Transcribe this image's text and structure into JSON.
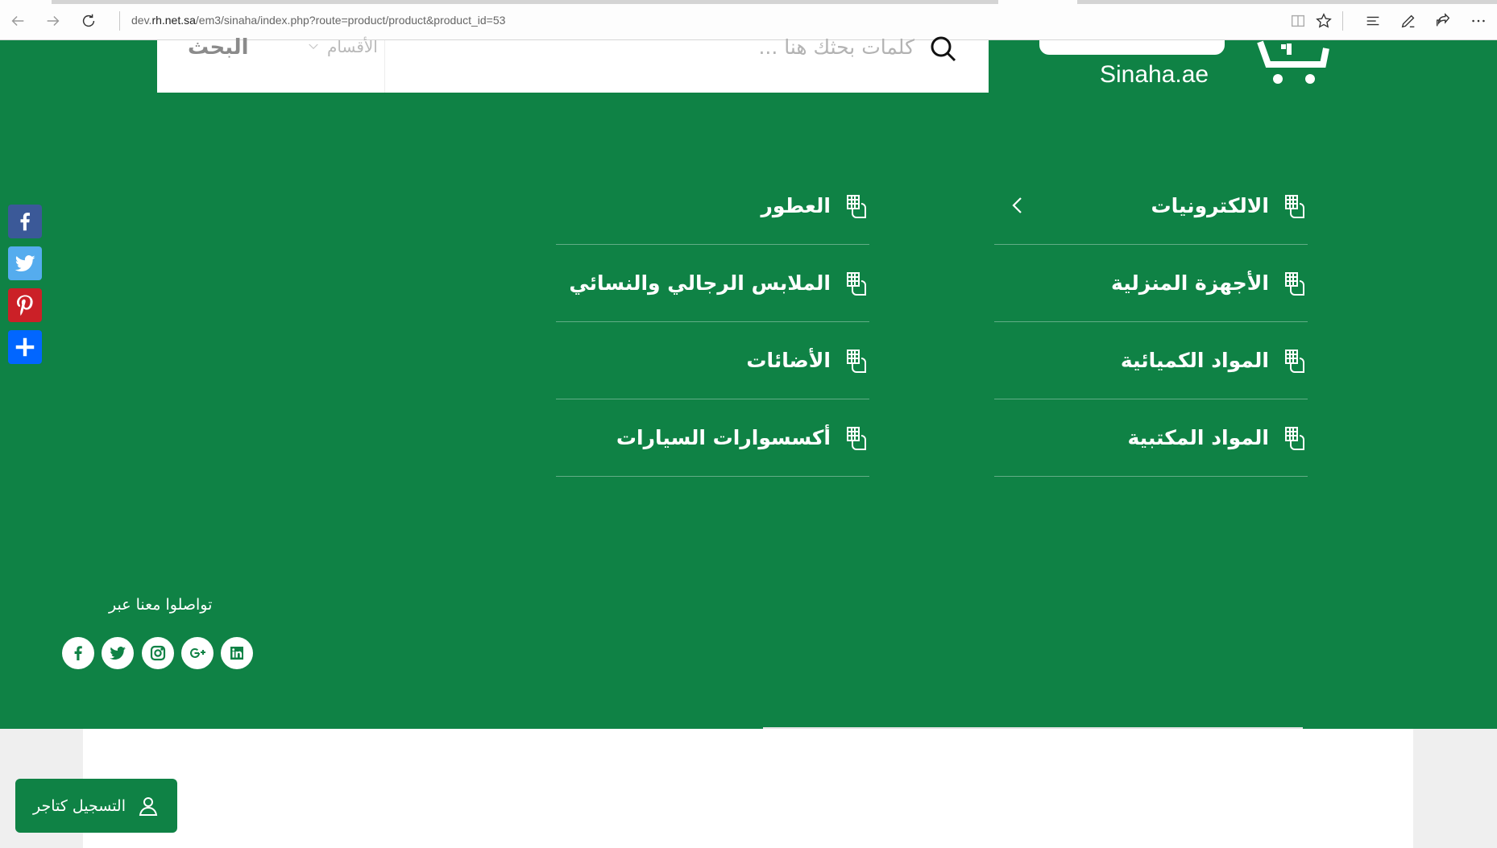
{
  "browser": {
    "url_prefix": "dev.",
    "url_domain": "rh.net.sa",
    "url_path": "/em3/sinaha/index.php?route=product/product&product_id=53",
    "icons": [
      "back-icon",
      "forward-icon",
      "refresh-icon",
      "reading-view-icon",
      "favorite-star-icon",
      "hub-icon",
      "web-note-icon",
      "share-icon",
      "more-icon"
    ]
  },
  "header": {
    "search_button_label": "البحث",
    "category_select_label": "الأقسام",
    "search_placeholder": "كلمات بحثك هنا ...",
    "logo_text": "Sinaha.ae"
  },
  "categories": {
    "right_column": [
      {
        "label": "الالكترونيات",
        "has_submenu": true
      },
      {
        "label": "الأجهزة المنزلية",
        "has_submenu": false
      },
      {
        "label": "المواد الكميائية",
        "has_submenu": false
      },
      {
        "label": "المواد المكتبية",
        "has_submenu": false
      }
    ],
    "left_column": [
      {
        "label": "العطور"
      },
      {
        "label": "الملابس الرجالي والنسائي"
      },
      {
        "label": "الأضائات"
      },
      {
        "label": "أكسسوارات السيارات"
      }
    ]
  },
  "share_sidebar": [
    {
      "name": "facebook",
      "color": "#3b5998"
    },
    {
      "name": "twitter",
      "color": "#55acee"
    },
    {
      "name": "pinterest",
      "color": "#cb2027"
    },
    {
      "name": "addthis-share",
      "color": "#0166ff"
    }
  ],
  "footer": {
    "contact_title": "تواصلوا معنا عبر",
    "social_icons": [
      "facebook-icon",
      "twitter-icon",
      "instagram-icon",
      "google-plus-icon",
      "linkedin-icon"
    ]
  },
  "register_button": {
    "label": "التسجيل كتاجر"
  },
  "colors": {
    "brand_green": "#0f8245",
    "white": "#ffffff"
  }
}
